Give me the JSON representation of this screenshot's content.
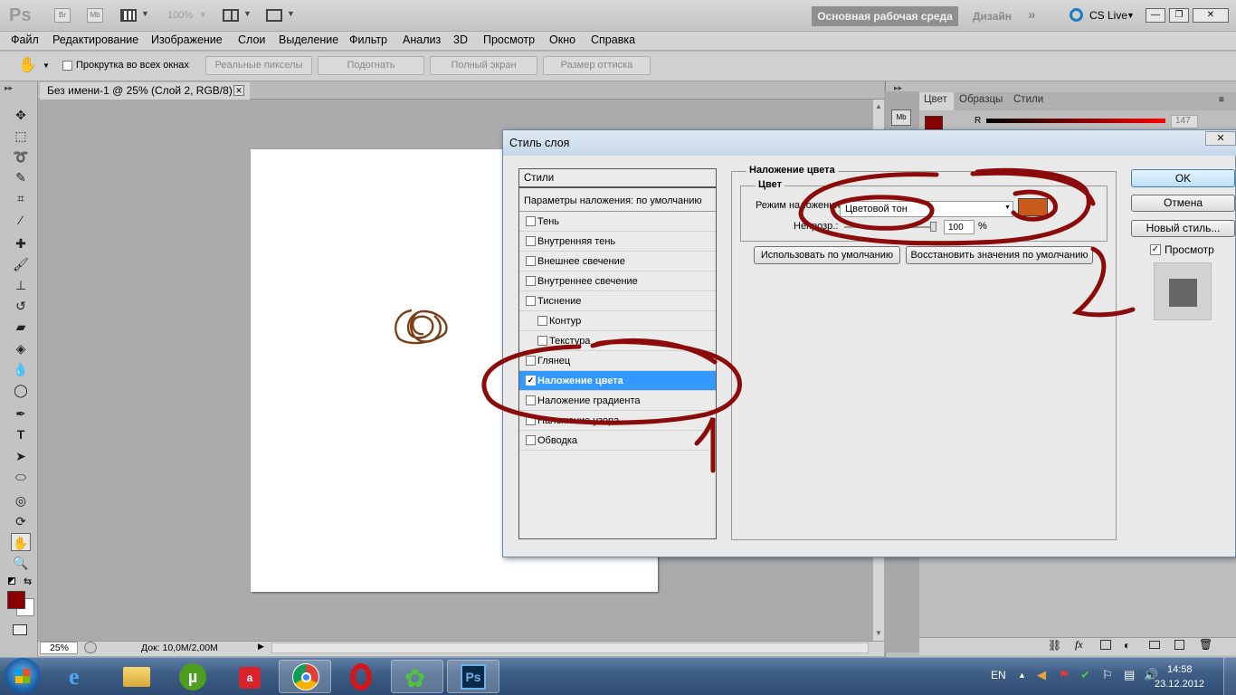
{
  "app": {
    "logo": "Ps",
    "zoom": "100%",
    "workspace_active": "Основная рабочая среда",
    "workspace_other": "Дизайн",
    "cs_live": "CS Live"
  },
  "menu": [
    "Файл",
    "Редактирование",
    "Изображение",
    "Слои",
    "Выделение",
    "Фильтр",
    "Анализ",
    "3D",
    "Просмотр",
    "Окно",
    "Справка"
  ],
  "options_bar": {
    "scroll_all_label": "Прокрутка во всех окнах",
    "buttons": [
      "Реальные пикселы",
      "Подогнать",
      "Полный экран",
      "Размер оттиска"
    ]
  },
  "document": {
    "tab_title": "Без имени-1 @ 25% (Слой 2, RGB/8) *",
    "zoom": "25%",
    "doc_size": "Док: 10,0M/2,00M"
  },
  "right_panel": {
    "tabs": [
      "Цвет",
      "Образцы",
      "Стили"
    ],
    "channel": "R",
    "value": "147"
  },
  "dialog": {
    "title": "Стиль слоя",
    "styles_header": "Стили",
    "defaults": "Параметры наложения: по умолчанию",
    "effects": [
      {
        "label": "Тень",
        "checked": false,
        "sub": false,
        "selected": false
      },
      {
        "label": "Внутренняя тень",
        "checked": false,
        "sub": false,
        "selected": false
      },
      {
        "label": "Внешнее свечение",
        "checked": false,
        "sub": false,
        "selected": false
      },
      {
        "label": "Внутреннее свечение",
        "checked": false,
        "sub": false,
        "selected": false
      },
      {
        "label": "Тиснение",
        "checked": false,
        "sub": false,
        "selected": false
      },
      {
        "label": "Контур",
        "checked": false,
        "sub": true,
        "selected": false
      },
      {
        "label": "Текстура",
        "checked": false,
        "sub": true,
        "selected": false
      },
      {
        "label": "Глянец",
        "checked": false,
        "sub": false,
        "selected": false
      },
      {
        "label": "Наложение цвета",
        "checked": true,
        "sub": false,
        "selected": true
      },
      {
        "label": "Наложение градиента",
        "checked": false,
        "sub": false,
        "selected": false
      },
      {
        "label": "Наложение узора",
        "checked": false,
        "sub": false,
        "selected": false
      },
      {
        "label": "Обводка",
        "checked": false,
        "sub": false,
        "selected": false
      }
    ],
    "group_title": "Наложение цвета",
    "subgroup_title": "Цвет",
    "blend_mode_label": "Режим наложения:",
    "blend_mode_value": "Цветовой тон",
    "overlay_color": "#c85a1c",
    "opacity_label": "Непрозр.:",
    "opacity_value": "100",
    "opacity_unit": "%",
    "btn_make_default": "Использовать по умолчанию",
    "btn_reset_default": "Восстановить значения по умолчанию",
    "btn_ok": "OK",
    "btn_cancel": "Отмена",
    "btn_new_style": "Новый стиль...",
    "preview_label": "Просмотр",
    "preview_checked": true
  },
  "annotations": {
    "mark_1": "1",
    "mark_2": "2",
    "color": "#8b0a0a"
  },
  "taskbar": {
    "lang": "EN",
    "time": "14:58",
    "date": "23.12.2012",
    "apps": [
      "internet-explorer",
      "file-explorer",
      "utorrent",
      "aimp",
      "chrome",
      "opera",
      "icq",
      "photoshop"
    ]
  },
  "colors": {
    "foreground": "#8b0000",
    "selection": "#3399ff"
  }
}
